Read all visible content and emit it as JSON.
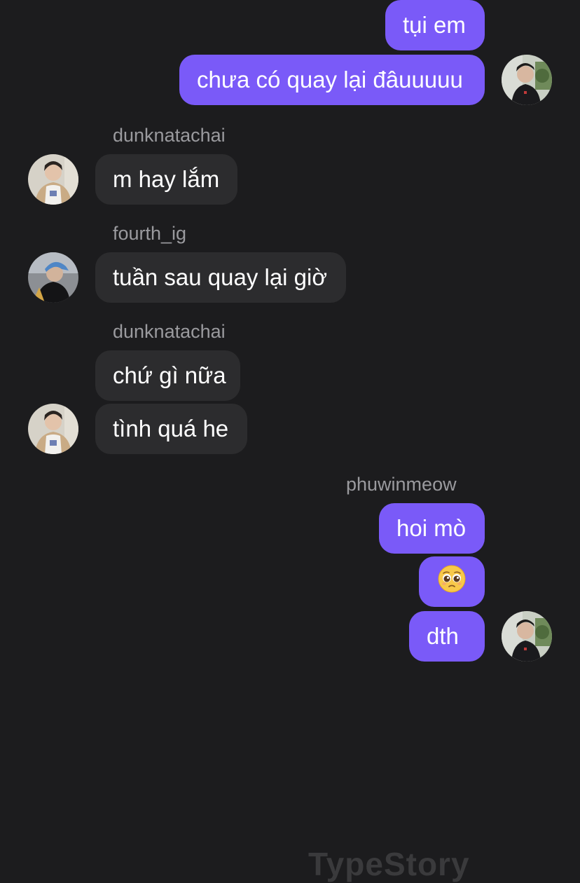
{
  "messages": [
    {
      "side": "out",
      "text": "tụi em"
    },
    {
      "side": "out",
      "text": "chưa có quay lại đâuuuuu"
    },
    {
      "side": "in",
      "sender": "dunknatachai",
      "text": "m hay lắm"
    },
    {
      "side": "in",
      "sender": "fourth_ig",
      "text": "tuần sau quay lại giờ"
    },
    {
      "side": "in",
      "sender": "dunknatachai",
      "text": "chứ gì nữa"
    },
    {
      "side": "in",
      "text": "tình quá he"
    },
    {
      "side": "out",
      "sender": "phuwinmeow",
      "text": "hoi mò"
    },
    {
      "side": "out",
      "emoji": "pleading-face",
      "text": ""
    },
    {
      "side": "out",
      "text": "dth"
    }
  ],
  "watermark": "TypeStory",
  "colors": {
    "background": "#1c1c1e",
    "outgoing_bubble": "#7a5af8",
    "incoming_bubble": "#2c2c2e",
    "sender_name": "#9a9a9e"
  },
  "icons": [
    "avatar-photo-icon",
    "pleading-face-emoji-icon"
  ]
}
